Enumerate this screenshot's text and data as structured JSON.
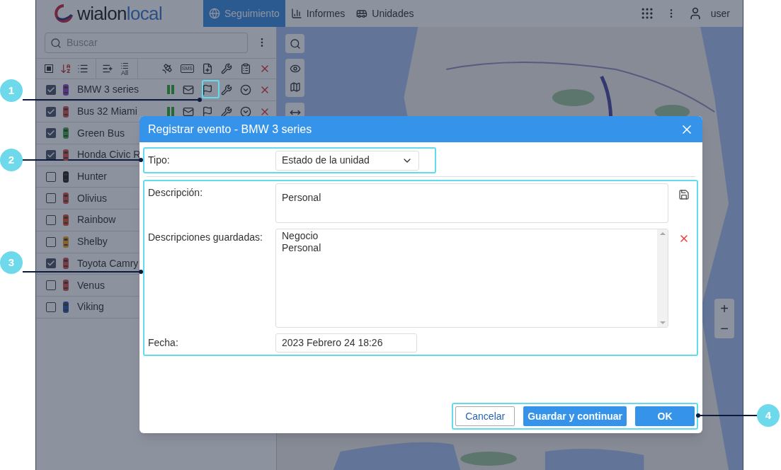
{
  "header": {
    "logo": {
      "name": "wialon",
      "suffix": "local"
    },
    "tabs": [
      {
        "label": "Seguimiento",
        "selected": true
      },
      {
        "label": "Informes",
        "selected": false
      },
      {
        "label": "Unidades",
        "selected": false
      }
    ],
    "user": "user"
  },
  "sidebar": {
    "search": {
      "placeholder": "Buscar"
    },
    "toolbar": {
      "all_label": "All",
      "sms_label": "SMS"
    },
    "units": [
      {
        "name": "BMW 3 series",
        "checked": true,
        "color": "#553584",
        "kind": "with_actions"
      },
      {
        "name": "Bus 32 Miami",
        "checked": true,
        "color": "#7a3c47",
        "kind": "with_actions"
      },
      {
        "name": "Green Bus",
        "checked": true,
        "color": "#2d6a44",
        "kind": "plain"
      },
      {
        "name": "Honda Civic R",
        "checked": true,
        "color": "#7a3c47",
        "kind": "plain"
      },
      {
        "name": "Hunter",
        "checked": false,
        "color": "#1f2431",
        "kind": "plain"
      },
      {
        "name": "Olivius",
        "checked": false,
        "color": "#7a3c47",
        "kind": "plain"
      },
      {
        "name": "Rainbow",
        "checked": false,
        "color": "#7e3b35",
        "kind": "plain"
      },
      {
        "name": "Shelby",
        "checked": false,
        "color": "#866330",
        "kind": "plain"
      },
      {
        "name": "Toyota Camry",
        "checked": true,
        "color": "#7a3c47",
        "kind": "plain"
      },
      {
        "name": "Venus",
        "checked": false,
        "color": "#7a3c47",
        "kind": "plain"
      },
      {
        "name": "Viking",
        "checked": false,
        "color": "#234074",
        "kind": "plain"
      }
    ]
  },
  "map": {
    "zoom_in": "+",
    "zoom_out": "−"
  },
  "dialog": {
    "title": "Registrar evento - BMW 3 series",
    "type": {
      "label": "Tipo:",
      "value": "Estado de la unidad"
    },
    "description": {
      "label": "Descripción:",
      "value": "Personal"
    },
    "saved": {
      "label": "Descripciones guardadas:",
      "items": [
        "Negocio",
        "Personal"
      ]
    },
    "date": {
      "label": "Fecha:",
      "value": "2023 Febrero 24 18:26"
    },
    "buttons": [
      {
        "label": "Cancelar",
        "kind": "secondary"
      },
      {
        "label": "Guardar y continuar",
        "kind": "primary"
      },
      {
        "label": "OK",
        "kind": "primary"
      }
    ]
  },
  "callouts": [
    "1",
    "2",
    "3",
    "4"
  ]
}
